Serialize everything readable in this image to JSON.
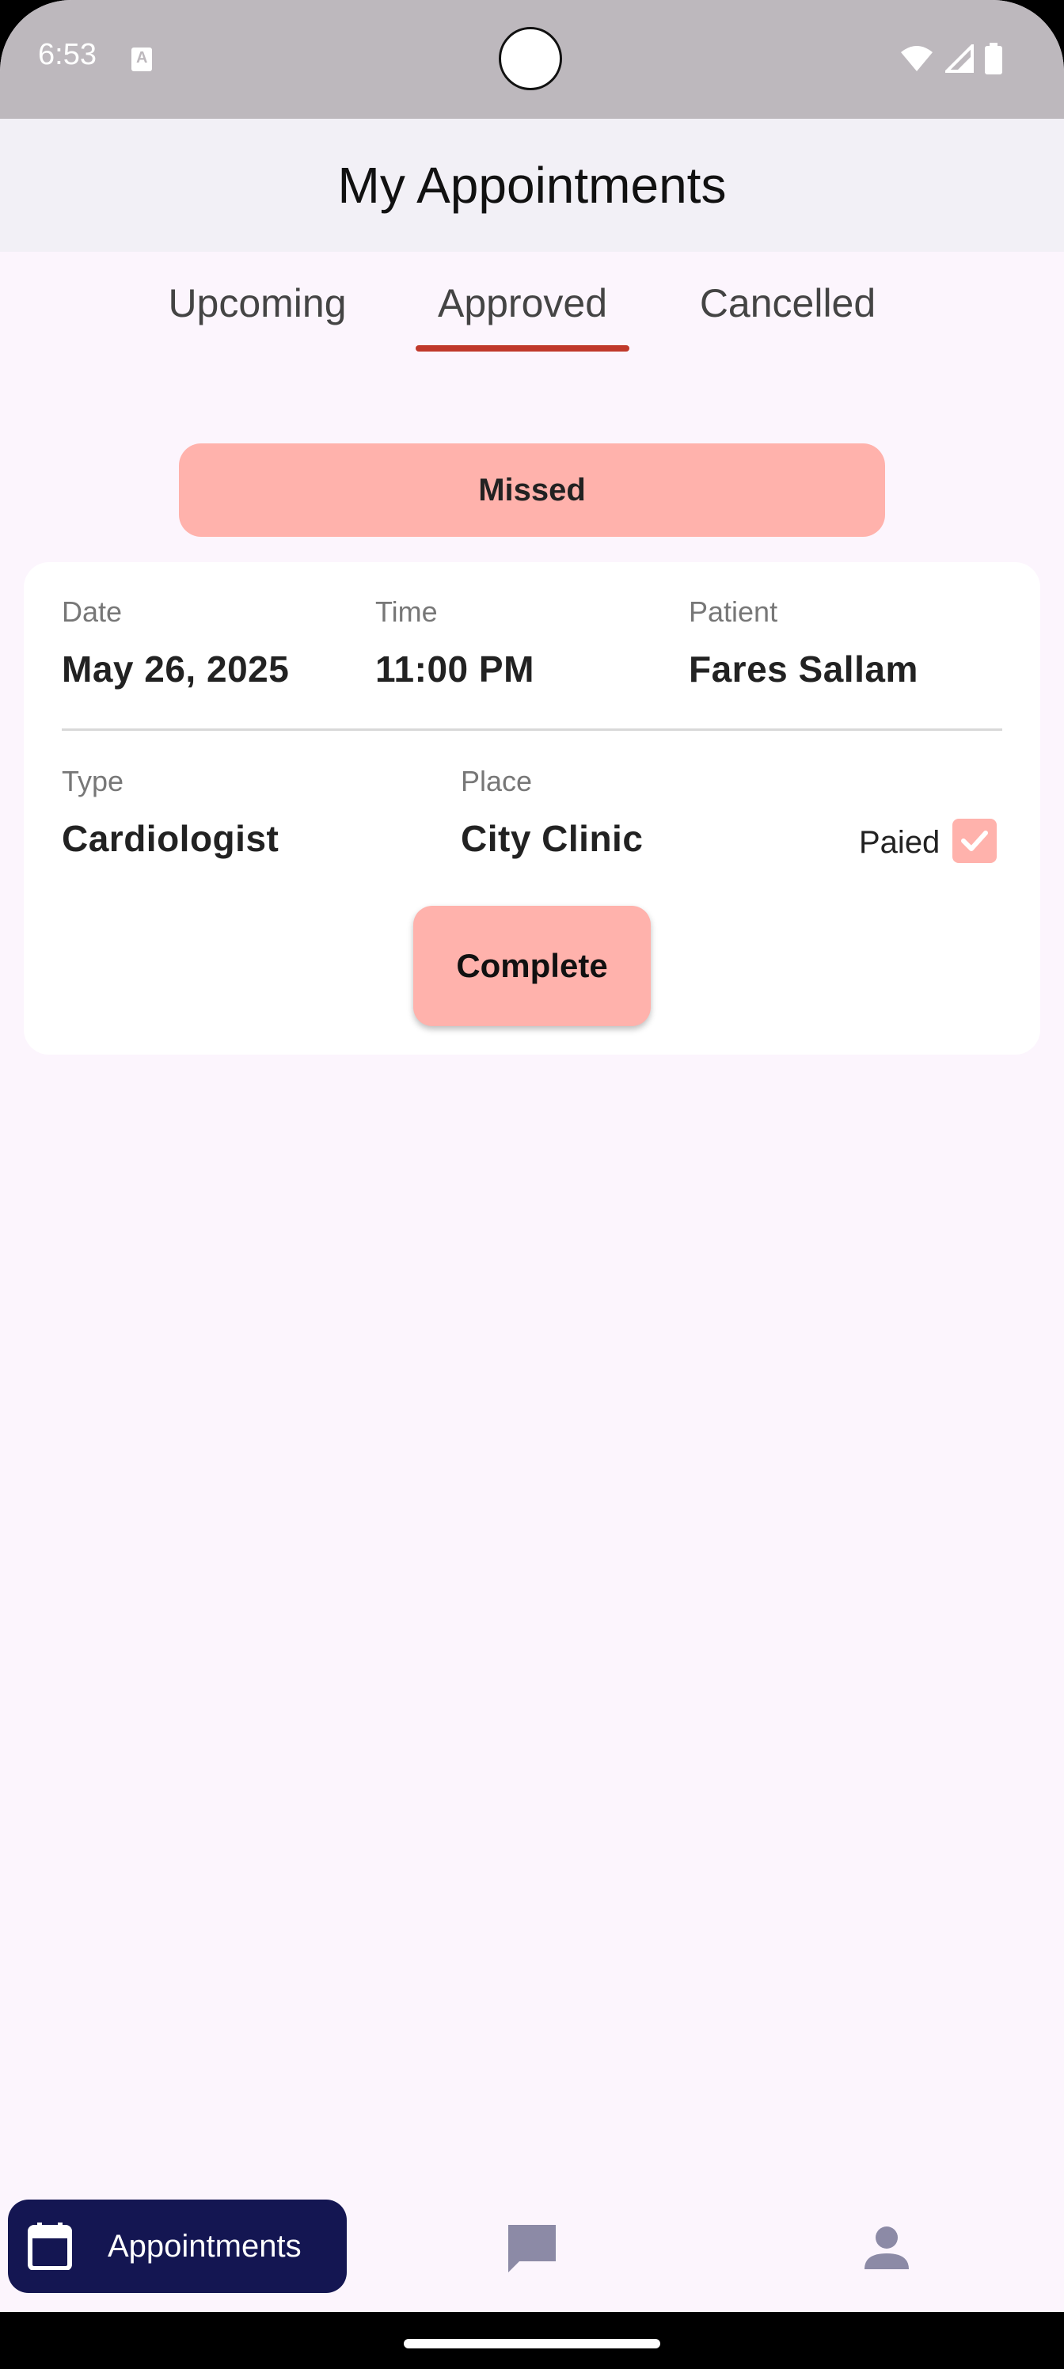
{
  "status_bar": {
    "time": "6:53"
  },
  "app_bar": {
    "title": "My Appointments"
  },
  "tabs": [
    {
      "label": "Upcoming",
      "selected": false
    },
    {
      "label": "Approved",
      "selected": true
    },
    {
      "label": "Cancelled",
      "selected": false
    }
  ],
  "status_pill": {
    "label": "Missed"
  },
  "appointment": {
    "date_label": "Date",
    "date_value": "May 26, 2025",
    "time_label": "Time",
    "time_value": "11:00 PM",
    "patient_label": "Patient",
    "patient_value": "Fares Sallam",
    "type_label": "Type",
    "type_value": "Cardiologist",
    "place_label": "Place",
    "place_value": "City Clinic",
    "paid_label": "Paied",
    "paid_checked": true,
    "complete_button": "Complete"
  },
  "bottom_nav": {
    "items": [
      {
        "label": "Appointments",
        "icon": "calendar-icon",
        "active": true
      },
      {
        "label": "",
        "icon": "chat-icon",
        "active": false
      },
      {
        "label": "",
        "icon": "person-icon",
        "active": false
      }
    ]
  },
  "colors": {
    "accent_pink": "#ffb2ac",
    "tab_indicator": "#c0392b",
    "nav_active": "#141652",
    "background": "#fcf5fd"
  }
}
